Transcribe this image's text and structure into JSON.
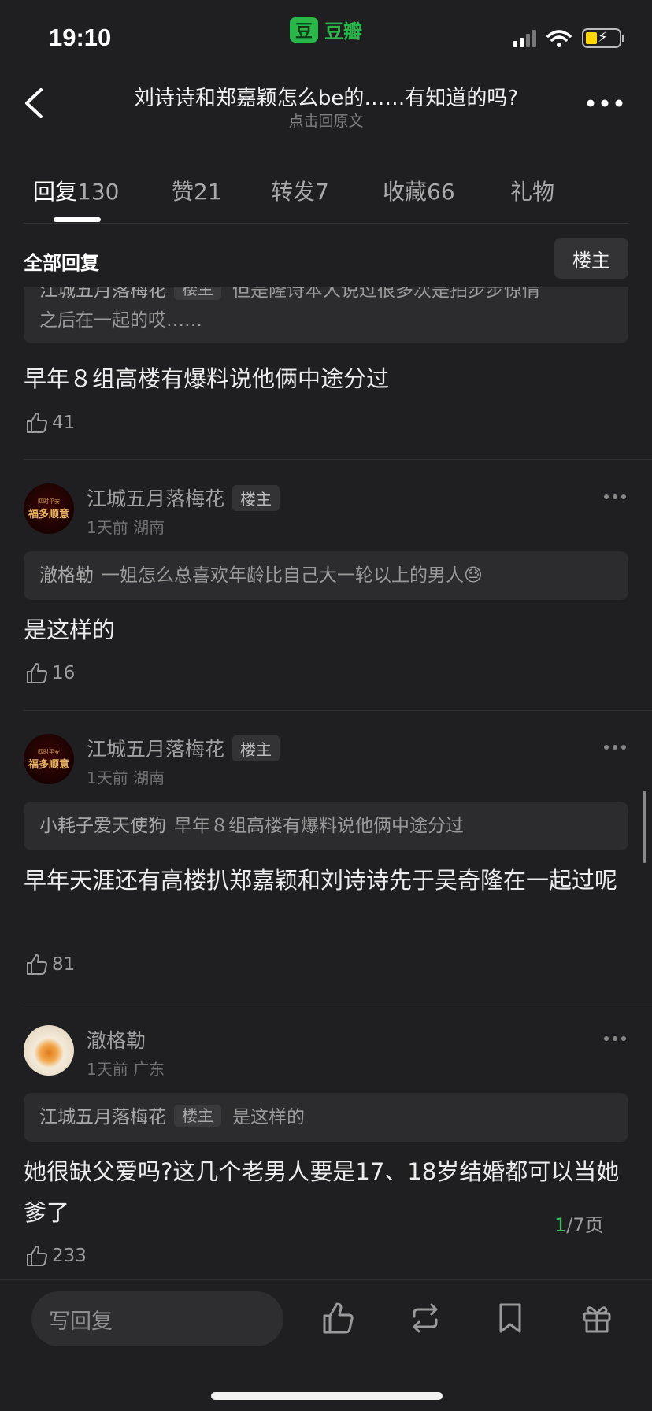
{
  "status": {
    "time": "19:10",
    "brand": "豆瓣",
    "brand_glyph": "豆"
  },
  "header": {
    "title": "刘诗诗和郑嘉颖怎么be的……有知道的吗?",
    "subtitle": "点击回原文"
  },
  "tabs": [
    {
      "label": "回复",
      "count": "130",
      "active": true
    },
    {
      "label": "赞",
      "count": "21"
    },
    {
      "label": "转发",
      "count": "7"
    },
    {
      "label": "收藏",
      "count": "66"
    },
    {
      "label": "礼物",
      "count": ""
    }
  ],
  "filter": {
    "all_replies": "全部回复",
    "op_only": "楼主"
  },
  "top_quote": {
    "name": "江城五月落梅花",
    "badge": "楼主",
    "text_line1": "但是隆诗本人说过很多次是拍步步惊情",
    "text_line2": "之后在一起的哎……"
  },
  "top_reply": {
    "text": "早年８组高楼有爆料说他俩中途分过",
    "likes": "41"
  },
  "comments": [
    {
      "name": "江城五月落梅花",
      "badge": "楼主",
      "meta": "1天前 湖南",
      "avatar_line1": "四时平安",
      "avatar_line2": "福多顺意",
      "quote_name": "澈格勒",
      "quote_text": "一姐怎么总喜欢年龄比自己大一轮以上的男人😓",
      "text": "是这样的",
      "likes": "16"
    },
    {
      "name": "江城五月落梅花",
      "badge": "楼主",
      "meta": "1天前 湖南",
      "avatar_line1": "四时平安",
      "avatar_line2": "福多顺意",
      "quote_name": "小耗子爱天使狗",
      "quote_text": "早年８组高楼有爆料说他俩中途分过",
      "text": "早年天涯还有高楼扒郑嘉颖和刘诗诗先于吴奇隆在一起过呢",
      "likes": "81"
    },
    {
      "name": "澈格勒",
      "meta": "1天前 广东",
      "quote_name": "江城五月落梅花",
      "quote_badge": "楼主",
      "quote_text": "是这样的",
      "text": "她很缺父爱吗?这几个老男人要是17、18岁结婚都可以当她爹了",
      "likes": "233"
    }
  ],
  "pager": {
    "current": "1",
    "total": "/7页"
  },
  "bottom": {
    "reply_placeholder": "写回复"
  },
  "colors": {
    "bg": "#1f1f21",
    "accent": "#2ab74a",
    "card": "#2c2c2e"
  }
}
